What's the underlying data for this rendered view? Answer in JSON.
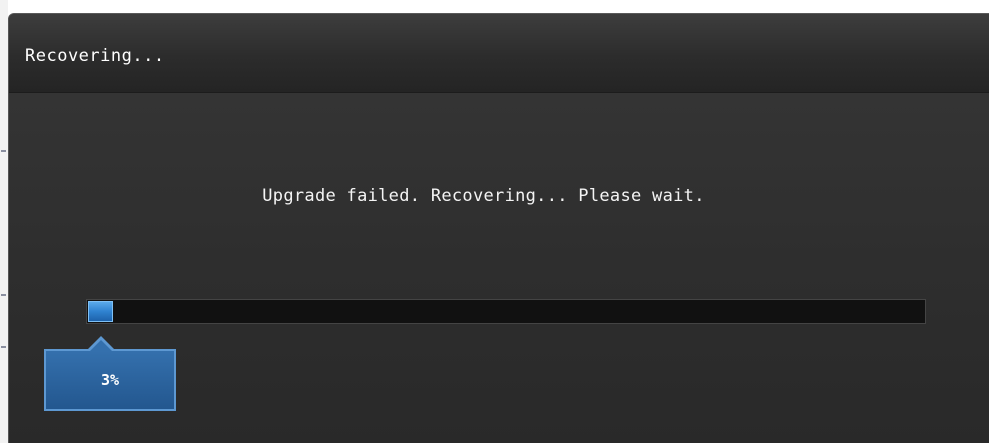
{
  "dialog": {
    "title": "Recovering...",
    "message": "Upgrade failed. Recovering... Please wait."
  },
  "progress": {
    "percent": 3,
    "label": "3%",
    "fill_color": "#2f82d0",
    "track_color": "#111111"
  }
}
